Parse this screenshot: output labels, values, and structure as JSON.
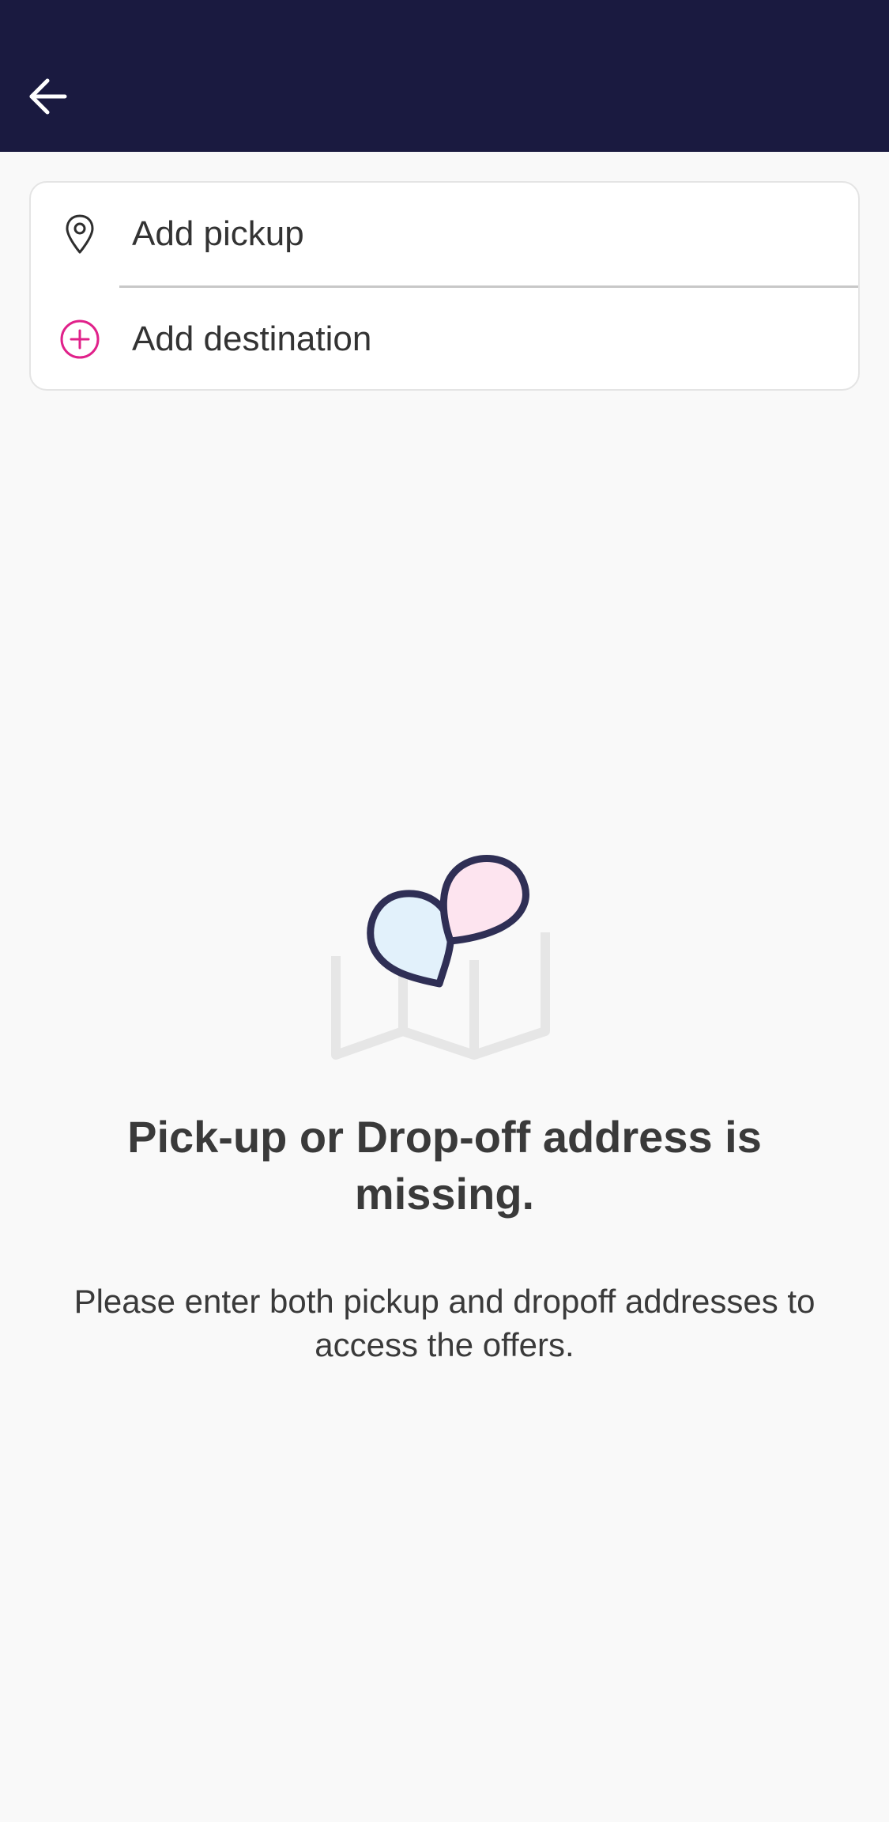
{
  "header": {
    "back_icon": "arrow-left-icon",
    "background": "#1a1a40"
  },
  "address_form": {
    "pickup": {
      "label": "Add pickup",
      "icon": "map-pin-icon"
    },
    "destination": {
      "label": "Add destination",
      "icon": "plus-circle-icon",
      "icon_color": "#e0218a"
    }
  },
  "empty_state": {
    "illustration": "map-with-location-pins-illustration",
    "title": "Pick-up or Drop-off address is missing.",
    "description": "Please enter both pickup and dropoff addresses to access the offers."
  }
}
